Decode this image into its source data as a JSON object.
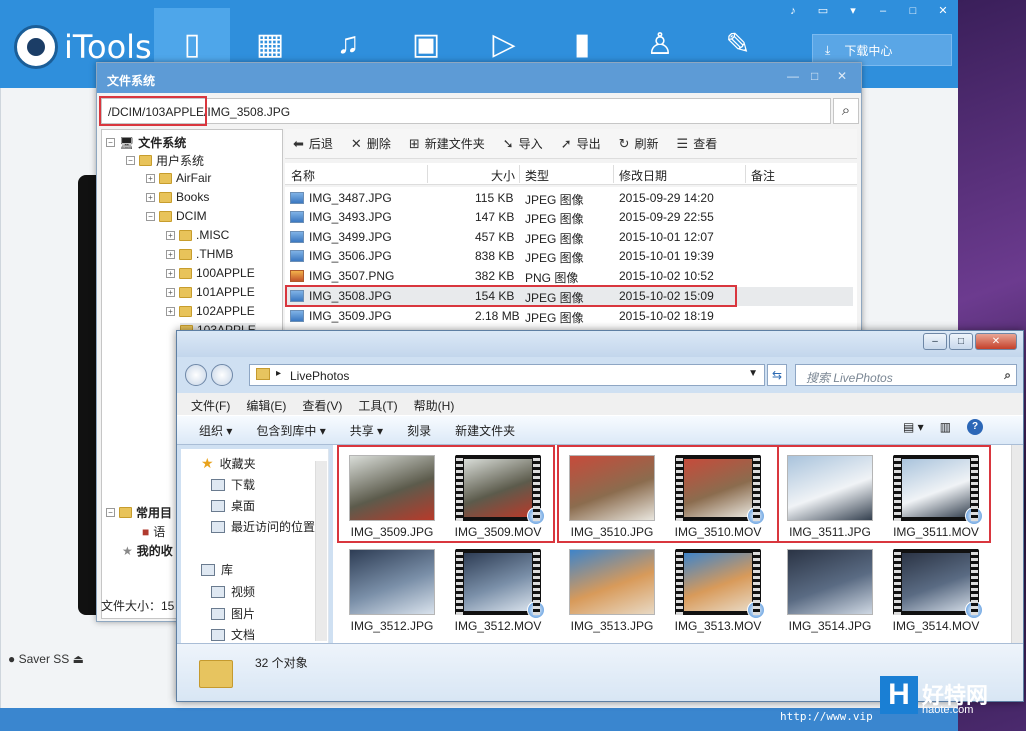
{
  "itools": {
    "app_name": "iTools",
    "download_center": "下载中心",
    "nav": [
      "device-icon",
      "apps-icon",
      "music-icon",
      "photos-icon",
      "video-icon",
      "books-icon",
      "contacts-icon",
      "tools-icon"
    ],
    "saver_label": "Saver SS"
  },
  "fs": {
    "title": "文件系统",
    "path": "/DCIM/103APPLE/IMG_3508.JPG",
    "tree": [
      {
        "label": "文件系统"
      },
      {
        "label": "用户系统"
      },
      {
        "label": "AirFair"
      },
      {
        "label": "Books"
      },
      {
        "label": "DCIM"
      },
      {
        "label": ".MISC"
      },
      {
        "label": ".THMB"
      },
      {
        "label": "100APPLE"
      },
      {
        "label": "101APPLE"
      },
      {
        "label": "102APPLE"
      },
      {
        "label": "103APPLE"
      },
      {
        "label": "常用目"
      },
      {
        "label": "语"
      },
      {
        "label": "我的收"
      }
    ],
    "toolbar": {
      "back": "后退",
      "delete": "删除",
      "new_folder": "新建文件夹",
      "import": "导入",
      "export": "导出",
      "refresh": "刷新",
      "view": "查看"
    },
    "columns": {
      "name": "名称",
      "size": "大小",
      "type": "类型",
      "date": "修改日期",
      "note": "备注"
    },
    "rows": [
      {
        "name": "IMG_3487.JPG",
        "size": "115 KB",
        "type": "JPEG 图像",
        "date": "2015-09-29 14:20"
      },
      {
        "name": "IMG_3493.JPG",
        "size": "147 KB",
        "type": "JPEG 图像",
        "date": "2015-09-29 22:55"
      },
      {
        "name": "IMG_3499.JPG",
        "size": "457 KB",
        "type": "JPEG 图像",
        "date": "2015-10-01 12:07"
      },
      {
        "name": "IMG_3506.JPG",
        "size": "838 KB",
        "type": "JPEG 图像",
        "date": "2015-10-01 19:39"
      },
      {
        "name": "IMG_3507.PNG",
        "size": "382 KB",
        "type": "PNG 图像",
        "date": "2015-10-02 10:52"
      },
      {
        "name": "IMG_3508.JPG",
        "size": "154 KB",
        "type": "JPEG 图像",
        "date": "2015-10-02 15:09"
      },
      {
        "name": "IMG_3509.JPG",
        "size": "2.18 MB",
        "type": "JPEG 图像",
        "date": "2015-10-02 18:19"
      }
    ],
    "status": "文件大小：15"
  },
  "explorer": {
    "breadcrumb": "LivePhotos",
    "search_placeholder": "搜索 LivePhotos",
    "menu": [
      "文件(F)",
      "编辑(E)",
      "查看(V)",
      "工具(T)",
      "帮助(H)"
    ],
    "commands": [
      "组织 ▾",
      "包含到库中 ▾",
      "共享 ▾",
      "刻录",
      "新建文件夹"
    ],
    "nav": [
      "收藏夹",
      "下载",
      "桌面",
      "最近访问的位置",
      "库",
      "视频",
      "图片",
      "文档"
    ],
    "thumbnails": [
      {
        "label": "IMG_3509.JPG",
        "kind": "photo",
        "colors": [
          "#d9ddd8",
          "#5c5b4c",
          "#b83a2a"
        ]
      },
      {
        "label": "IMG_3509.MOV",
        "kind": "video",
        "colors": [
          "#d9ddd8",
          "#5c5b4c",
          "#b83a2a"
        ]
      },
      {
        "label": "IMG_3510.JPG",
        "kind": "photo",
        "colors": [
          "#c64b3b",
          "#8b6c4e",
          "#e9e6de"
        ]
      },
      {
        "label": "IMG_3510.MOV",
        "kind": "video",
        "colors": [
          "#c64b3b",
          "#8b6c4e",
          "#e9e6de"
        ]
      },
      {
        "label": "IMG_3511.JPG",
        "kind": "photo",
        "colors": [
          "#a9c3dc",
          "#f0f3f6",
          "#34404f"
        ]
      },
      {
        "label": "IMG_3511.MOV",
        "kind": "video",
        "colors": [
          "#a9c3dc",
          "#f0f3f6",
          "#34404f"
        ]
      },
      {
        "label": "IMG_3512.JPG",
        "kind": "photo",
        "colors": [
          "#2e3d55",
          "#7a8fa8",
          "#d9e2ec"
        ]
      },
      {
        "label": "IMG_3512.MOV",
        "kind": "video",
        "colors": [
          "#2e3d55",
          "#7a8fa8",
          "#d9e2ec"
        ]
      },
      {
        "label": "IMG_3513.JPG",
        "kind": "photo",
        "colors": [
          "#3f84c9",
          "#d89a5a",
          "#e8d9c4"
        ]
      },
      {
        "label": "IMG_3513.MOV",
        "kind": "video",
        "colors": [
          "#3f84c9",
          "#d89a5a",
          "#e8d9c4"
        ]
      },
      {
        "label": "IMG_3514.JPG",
        "kind": "photo",
        "colors": [
          "#2b3445",
          "#5a6b83",
          "#cfd8e3"
        ]
      },
      {
        "label": "IMG_3514.MOV",
        "kind": "video",
        "colors": [
          "#2b3445",
          "#5a6b83",
          "#cfd8e3"
        ]
      }
    ],
    "count": "32 个对象"
  },
  "watermark": {
    "mark": "H",
    "name": "好特网",
    "site": "haote.com",
    "url": "http://www.vip"
  }
}
